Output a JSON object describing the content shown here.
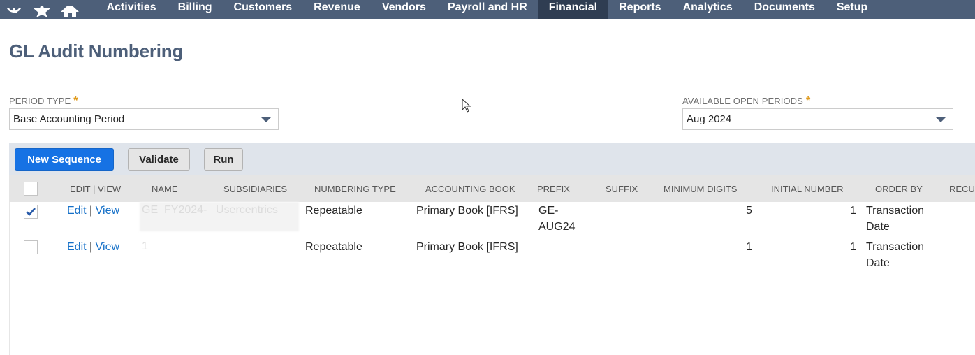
{
  "nav": {
    "items": [
      "Activities",
      "Billing",
      "Customers",
      "Revenue",
      "Vendors",
      "Payroll and HR",
      "Financial",
      "Reports",
      "Analytics",
      "Documents",
      "Setup"
    ],
    "active": "Financial",
    "icons": [
      "recent-icon",
      "star-icon",
      "home-icon"
    ]
  },
  "page": {
    "title": "GL Audit Numbering"
  },
  "form": {
    "period_type": {
      "label": "PERIOD TYPE",
      "required": "*",
      "value": "Base Accounting Period"
    },
    "open_periods": {
      "label": "AVAILABLE OPEN PERIODS",
      "required": "*",
      "value": "Aug 2024"
    }
  },
  "toolbar": {
    "new_sequence": "New Sequence",
    "validate": "Validate",
    "run": "Run"
  },
  "table": {
    "columns": [
      "EDIT | VIEW",
      "NAME",
      "SUBSIDIARIES",
      "NUMBERING TYPE",
      "ACCOUNTING BOOK",
      "PREFIX",
      "SUFFIX",
      "MINIMUM DIGITS",
      "INITIAL NUMBER",
      "ORDER BY",
      "RECUR"
    ],
    "rows": [
      {
        "checked": true,
        "edit": "Edit",
        "sep": "|",
        "view": "View",
        "name": "GE_FY2024-",
        "subsidiaries": "Usercentrics",
        "numbering_type": "Repeatable",
        "accounting_book": "Primary Book [IFRS]",
        "prefix_1": "GE-",
        "prefix_2": "AUG24",
        "suffix": "",
        "minimum_digits": "5",
        "initial_number": "1",
        "order_by_1": "Transaction",
        "order_by_2": "Date"
      },
      {
        "checked": false,
        "edit": "Edit",
        "sep": "|",
        "view": "View",
        "name": "1",
        "subsidiaries": "",
        "numbering_type": "Repeatable",
        "accounting_book": "Primary Book [IFRS]",
        "prefix_1": "",
        "prefix_2": "",
        "suffix": "",
        "minimum_digits": "1",
        "initial_number": "1",
        "order_by_1": "Transaction",
        "order_by_2": "Date"
      }
    ]
  },
  "colors": {
    "nav_bg": "#4d5f79",
    "nav_active": "#2f3d52",
    "primary": "#1672e4",
    "required": "#e09a1b",
    "link": "#1570c8"
  }
}
